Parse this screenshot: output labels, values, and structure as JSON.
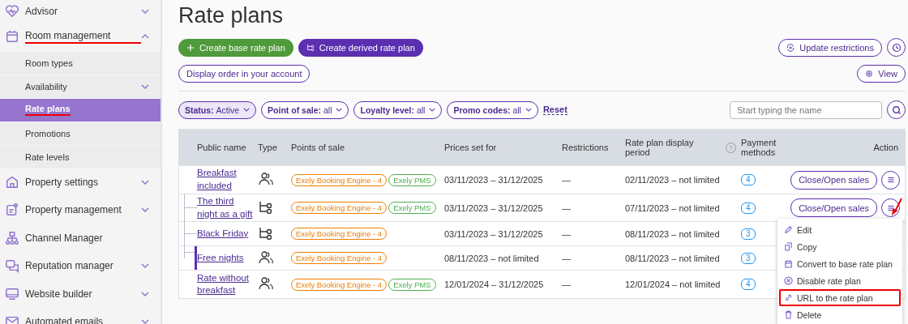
{
  "sidebar": {
    "items": [
      {
        "label": "Advisor",
        "kind": "heart",
        "expanded": false,
        "has_children": true,
        "annotated": false
      },
      {
        "label": "Room management",
        "kind": "calendar",
        "expanded": true,
        "has_children": true,
        "annotated": true,
        "children": [
          {
            "label": "Room types",
            "selected": false,
            "has_children": false,
            "annotated": false
          },
          {
            "label": "Availability",
            "selected": false,
            "has_children": true,
            "annotated": false
          },
          {
            "label": "Rate plans",
            "selected": true,
            "has_children": false,
            "annotated": true
          },
          {
            "label": "Promotions",
            "selected": false,
            "has_children": false,
            "annotated": false
          },
          {
            "label": "Rate levels",
            "selected": false,
            "has_children": false,
            "annotated": false
          }
        ]
      },
      {
        "label": "Property settings",
        "kind": "home",
        "expanded": false,
        "has_children": true,
        "annotated": false
      },
      {
        "label": "Property management",
        "kind": "card",
        "expanded": false,
        "has_children": true,
        "annotated": false
      },
      {
        "label": "Channel Manager",
        "kind": "sitemap",
        "expanded": false,
        "has_children": false,
        "annotated": false
      },
      {
        "label": "Reputation manager",
        "kind": "chat",
        "expanded": false,
        "has_children": true,
        "annotated": false
      },
      {
        "label": "Website builder",
        "kind": "monitor",
        "expanded": false,
        "has_children": true,
        "annotated": false
      },
      {
        "label": "Automated emails",
        "kind": "mail",
        "expanded": false,
        "has_children": true,
        "annotated": false
      }
    ]
  },
  "page": {
    "title": "Rate plans",
    "create_base_button": "Create base rate plan",
    "create_derived_button": "Create derived rate plan",
    "display_order_button": "Display order in your account",
    "update_restrictions_button": "Update restrictions",
    "view_button": "View"
  },
  "filters": [
    {
      "key": "Status:",
      "value": "Active",
      "selected": true
    },
    {
      "key": "Point of sale:",
      "value": "all",
      "selected": false
    },
    {
      "key": "Loyalty level:",
      "value": "all",
      "selected": false
    },
    {
      "key": "Promo codes:",
      "value": "all",
      "selected": false
    }
  ],
  "reset_link": "Reset",
  "search": {
    "placeholder": "Start typing the name"
  },
  "table": {
    "columns": [
      "Public name",
      "Type",
      "Points of sale",
      "Prices set for",
      "Restrictions",
      "Rate plan display period",
      "Payment methods",
      "Action"
    ],
    "period_help": "?",
    "rows": [
      {
        "name": "Breakfast included",
        "kind": "base",
        "points": [
          {
            "label": "Exely Booking Engine - 4",
            "color": "#ef7d00"
          },
          {
            "label": "Exely PMS",
            "color": "#4caf50"
          }
        ],
        "prices": "03/11/2023 – 31/12/2025",
        "restrictions": "—",
        "period": "02/11/2023 – not limited",
        "payment": "4",
        "action": "Close/Open sales",
        "selected": false,
        "children": [
          {
            "name": "The third night as a gift",
            "kind": "derived",
            "points": [
              {
                "label": "Exely Booking Engine - 4",
                "color": "#ef7d00"
              },
              {
                "label": "Exely PMS",
                "color": "#4caf50"
              }
            ],
            "prices": "03/11/2023 – 31/12/2025",
            "restrictions": "—",
            "period": "07/11/2023 – not limited",
            "payment": "4",
            "action": "Close/Open sales",
            "selected": false
          },
          {
            "name": "Black Friday",
            "kind": "derived",
            "points": [
              {
                "label": "Exely Booking Engine - 4",
                "color": "#ef7d00"
              }
            ],
            "prices": "03/11/2023 – 31/12/2025",
            "restrictions": "—",
            "period": "08/11/2023 – not limited",
            "payment": "3",
            "selected": false
          },
          {
            "name": "Free nights",
            "kind": "base",
            "points": [
              {
                "label": "Exely Booking Engine - 4",
                "color": "#ef7d00"
              }
            ],
            "prices": "08/11/2023 – not limited",
            "restrictions": "—",
            "period": "08/11/2023 – not limited",
            "payment": "3",
            "selected": true
          }
        ]
      },
      {
        "name": "Rate without breakfast",
        "kind": "base",
        "points": [
          {
            "label": "Exely Booking Engine - 4",
            "color": "#ef7d00"
          },
          {
            "label": "Exely PMS",
            "color": "#4caf50"
          }
        ],
        "prices": "12/01/2024 – 31/12/2025",
        "restrictions": "—",
        "period": "12/01/2024 – not limited",
        "payment": "4",
        "selected": false
      }
    ]
  },
  "action_menu": {
    "items": [
      {
        "label": "Edit",
        "kind": "pencil",
        "highlighted": false
      },
      {
        "label": "Copy",
        "kind": "copy",
        "highlighted": false
      },
      {
        "label": "Convert to base rate plan",
        "kind": "calendar",
        "highlighted": false
      },
      {
        "label": "Disable rate plan",
        "kind": "xcircle",
        "highlighted": false
      },
      {
        "label": "URL to the rate plan",
        "kind": "link",
        "highlighted": true
      },
      {
        "label": "Delete",
        "kind": "trash",
        "highlighted": false
      }
    ]
  }
}
